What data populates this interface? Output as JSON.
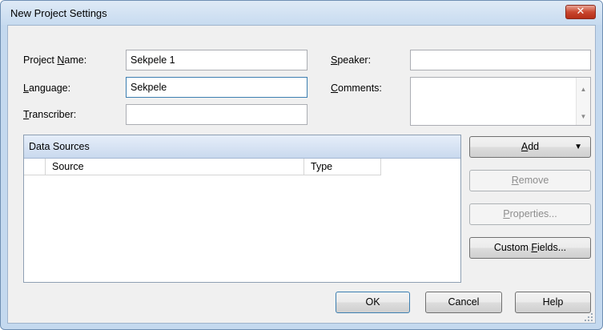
{
  "window": {
    "title": "New Project Settings",
    "close_label": "✕"
  },
  "fields": {
    "project_name": {
      "label_pre": "Project ",
      "label_u": "N",
      "label_post": "ame:",
      "value": "Sekpele 1"
    },
    "language": {
      "label_pre": "",
      "label_u": "L",
      "label_post": "anguage:",
      "value": "Sekpele"
    },
    "transcriber": {
      "label_pre": "",
      "label_u": "T",
      "label_post": "ranscriber:",
      "value": ""
    },
    "speaker": {
      "label_pre": "",
      "label_u": "S",
      "label_post": "peaker:",
      "value": ""
    },
    "comments": {
      "label_pre": "",
      "label_u": "C",
      "label_post": "omments:",
      "value": ""
    }
  },
  "data_sources": {
    "title": "Data Sources",
    "columns": [
      "Source",
      "Type"
    ],
    "rows": []
  },
  "side_buttons": {
    "add": {
      "u": "A",
      "rest": "dd"
    },
    "remove": {
      "u": "R",
      "rest": "emove"
    },
    "properties": {
      "u": "P",
      "rest": "roperties..."
    },
    "custom_fields": {
      "pre": "Custom ",
      "u": "F",
      "rest": "ields..."
    }
  },
  "footer": {
    "ok": "OK",
    "cancel": "Cancel",
    "help": "Help"
  }
}
